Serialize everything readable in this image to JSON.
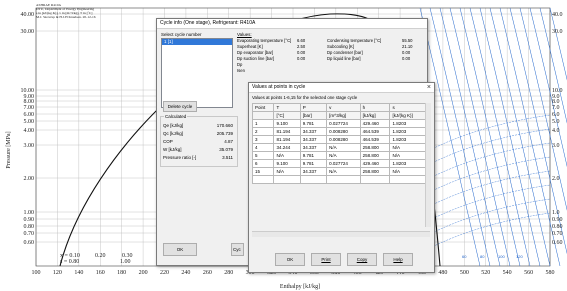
{
  "chart": {
    "header_lines": [
      "ASHRAE R410A",
      "DTU, Department of Energy Engineering",
      "s in [kJ/(kg K)], v in [m^3/kg], T in [ºC]",
      "M.J. Skovrup & H.J.H Knudsen. 20-12-16"
    ],
    "xlabel": "Enthalpy [kJ/kg]",
    "ylabel": "Pressure [MPa]",
    "x_ticks": [
      "100",
      "120",
      "140",
      "160",
      "180",
      "200",
      "220",
      "240",
      "260",
      "280",
      "300",
      "320",
      "340",
      "360",
      "380",
      "400",
      "420",
      "440",
      "460",
      "480",
      "500",
      "520",
      "540",
      "560",
      "580"
    ],
    "y_ticks_left": [
      "40.00",
      "30.00",
      "10.00",
      "9.00",
      "8.00",
      "7.00",
      "6.00",
      "5.00",
      "4.00",
      "3.00",
      "2.00",
      "1.00",
      "0.90",
      "0.80",
      "0.70",
      "0.60"
    ],
    "y_ticks_right": [
      "40.0",
      "30.0",
      "10.0",
      "9.0",
      "8.0",
      "7.0",
      "6.0",
      "5.0",
      "4.0",
      "3.0",
      "2.0",
      "1.0",
      "0.90",
      "0.80",
      "0.70",
      "0.60"
    ],
    "quality_labels": [
      "x = 0.10",
      "0.20",
      "0.30",
      "s = 0.80",
      "1.00",
      "1.20",
      "1.40"
    ],
    "isotherm_labels": [
      "60",
      "80",
      "100",
      "120"
    ],
    "colors": {
      "isoline": "#2266cc",
      "grid": "#b8b8b8",
      "dome": "#111111"
    }
  },
  "cycle_window": {
    "title": "Cycle info (One stage), Refrigerant: R410A",
    "select_label": "Select cycle number",
    "cycles": [
      "1 [1]"
    ],
    "delete_label": "Delete cycle",
    "ok_label": "OK",
    "cyc_label": "Cyc",
    "calculated_label": "Calculated",
    "calculated": [
      {
        "k": "Qe [kJ/kg]",
        "v": "170.660"
      },
      {
        "k": "Qc [kJ/kg]",
        "v": "205.739"
      },
      {
        "k": "COP",
        "v": "4.87"
      },
      {
        "k": "W [kJ/kg]",
        "v": "35.079"
      },
      {
        "k": "Pressure ratio [-]",
        "v": "3.511"
      }
    ],
    "values_label": "Values:",
    "values": [
      {
        "k": "Evaporating temperature [°C]",
        "v": "6.60",
        "k2": "Condensing temperature [°C]",
        "v2": "55.50"
      },
      {
        "k": "Superheat [K]",
        "v": "2.50",
        "k2": "Subcooling [K]",
        "v2": "21.10"
      },
      {
        "k": "Dp evaporator [bar]",
        "v": "0.00",
        "k2": "Dp condenser [bar]",
        "v2": "0.00"
      },
      {
        "k": "Dp suction line [bar]",
        "v": "0.00",
        "k2": "Dp liquid line [bar]",
        "v2": "0.00"
      },
      {
        "k": "Dp",
        "v": "",
        "k2": "",
        "v2": ""
      },
      {
        "k": "Isen",
        "v": "",
        "k2": "",
        "v2": ""
      }
    ]
  },
  "points_window": {
    "title": "Values at points in cycle",
    "subtitle": "Values at points 1-6,15 for the selected one stage cycle",
    "headers": [
      "Point",
      "T",
      "P",
      "v",
      "h",
      "s"
    ],
    "units": [
      "",
      "[°C]",
      "[bar]",
      "[m^3/kg]",
      "[kJ/kg]",
      "[kJ/(kg K)]"
    ],
    "rows": [
      [
        "1",
        "9.100",
        "9.781",
        "0.027724",
        "429.460",
        "1.8203"
      ],
      [
        "2",
        "81.194",
        "34.337",
        "0.008280",
        "464.539",
        "1.8203"
      ],
      [
        "3",
        "81.194",
        "34.337",
        "0.008280",
        "464.539",
        "1.8203"
      ],
      [
        "4",
        "34.244",
        "34.337",
        "N/A",
        "258.800",
        "N/A"
      ],
      [
        "5",
        "N/A",
        "9.781",
        "N/A",
        "258.800",
        "N/A"
      ],
      [
        "6",
        "9.100",
        "9.781",
        "0.027724",
        "429.460",
        "1.8203"
      ],
      [
        "15",
        "N/A",
        "34.337",
        "N/A",
        "258.800",
        "N/A"
      ]
    ],
    "buttons": {
      "ok": "OK",
      "print": "Print",
      "copy": "Copy",
      "help": "Help"
    }
  }
}
